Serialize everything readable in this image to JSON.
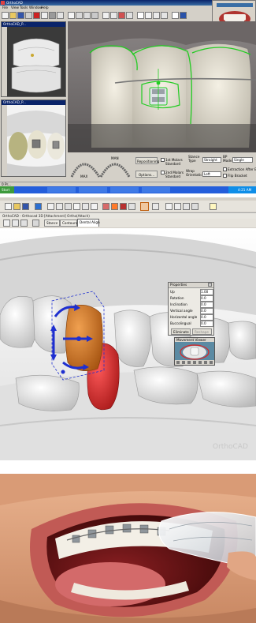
{
  "app1": {
    "title": "OrthoCAD",
    "menu": [
      "File",
      "View",
      "Tools",
      "Window",
      "Help"
    ],
    "left_panel_1_title": "OrthoCAD_P...",
    "left_panel_2_title": "OrthoCAD_P...",
    "buttons": {
      "repositioning": "Repositioning",
      "options": "Options...",
      "jaw_help": "Jaw Help",
      "first_slot_standard": "1st Molars Standard",
      "second_slot_standard": "2nd Molars Standard",
      "stance_type": "Stance Type",
      "wrap_orientation": "Wrap Orientation",
      "bp_mode": "BP Mode",
      "extraction_after_bonding": "Extraction After Bonding",
      "flip_bracket": "Flip Bracket"
    },
    "selects": {
      "stance": "Straight",
      "wrap": "Left",
      "bp_mode": "Single"
    },
    "arch_labels": {
      "maxillary": "MAX",
      "mandibular": "MAN"
    },
    "status_left": "0 Pr...",
    "taskbar": {
      "start": "Start",
      "clock": "4:21 AM"
    },
    "colors": {
      "bracket_outline": "#22cc22",
      "title_bar": "#0a246a"
    }
  },
  "app2": {
    "title": "OrthoCAD - Orthocad 3D [Attachment] Ortho(Attach)",
    "tabs": [
      "Stance",
      "Contours",
      "Dental Align"
    ],
    "panel": {
      "title": "Properties",
      "rows": [
        {
          "label": "Up",
          "value": "1.00"
        },
        {
          "label": "Rotation",
          "value": "0.0"
        },
        {
          "label": "Inclination",
          "value": "0.0"
        },
        {
          "label": "Vertical angle",
          "value": "0.0"
        },
        {
          "label": "Horizontal angle",
          "value": "0.0"
        },
        {
          "label": "Buccolingual",
          "value": "0.0"
        }
      ],
      "btn_left": "Eliminate",
      "btn_right": "Reshape",
      "preview_title": "Movement Viewer"
    },
    "watermark": "OrthoCAD",
    "colors": {
      "attachment": "#c86e1a",
      "tooth_red": "#cc1f1f",
      "arrows": "#1e2fd0"
    }
  }
}
